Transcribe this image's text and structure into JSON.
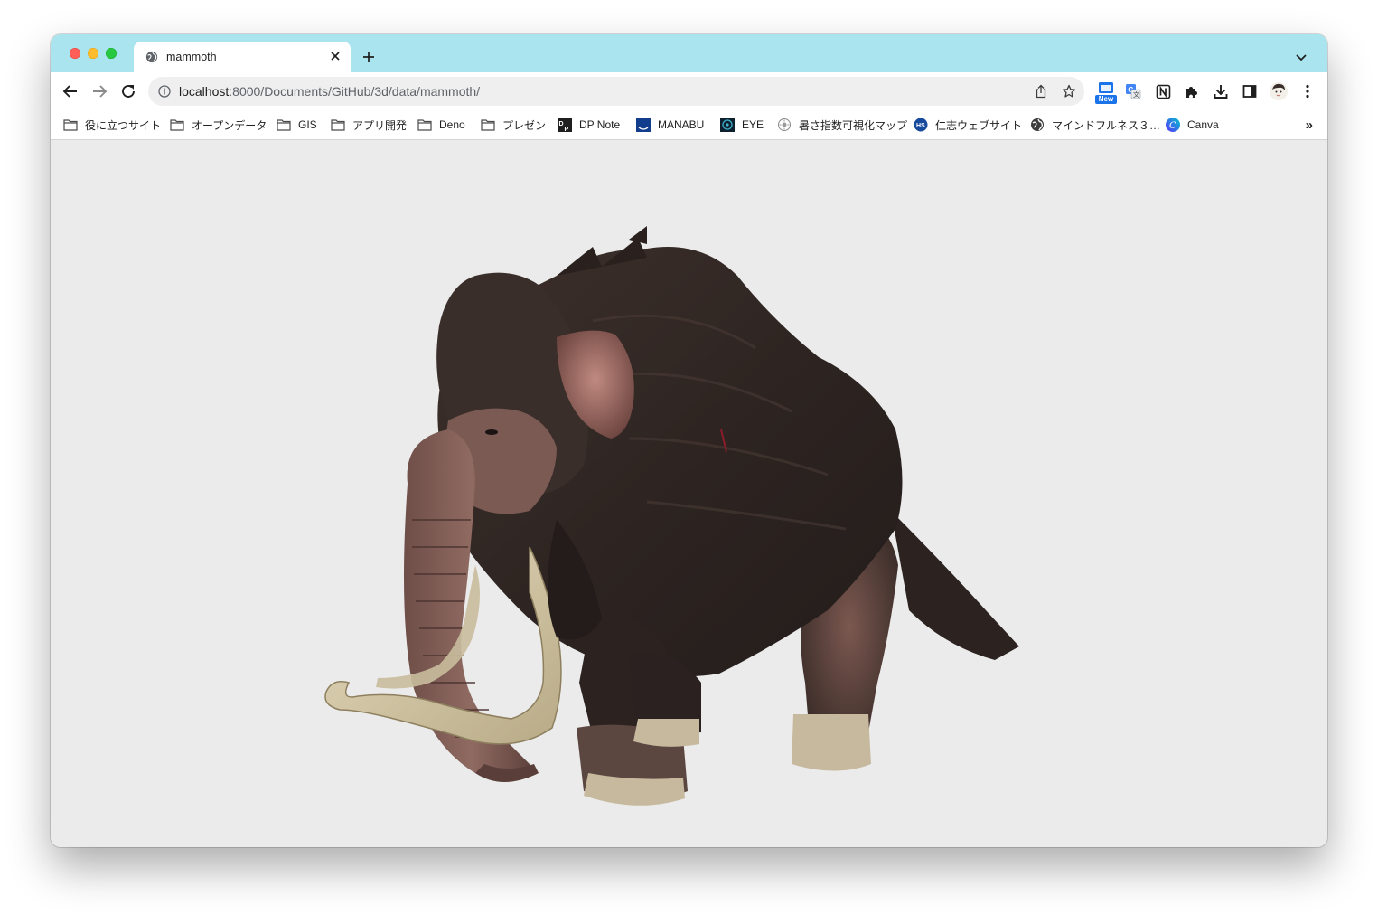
{
  "tab": {
    "title": "mammoth",
    "favicon": "globe-icon"
  },
  "toolbar": {
    "url_host": "localhost",
    "url_path": ":8000/Documents/GitHub/3d/data/mammoth/",
    "new_badge": "New"
  },
  "bookmarks": [
    {
      "label": "役に立つサイト",
      "icon": "folder-icon"
    },
    {
      "label": "オープンデータ",
      "icon": "folder-icon"
    },
    {
      "label": "GIS",
      "icon": "folder-icon"
    },
    {
      "label": "アプリ開発",
      "icon": "folder-icon"
    },
    {
      "label": "Deno",
      "icon": "folder-icon"
    },
    {
      "label": "プレゼン",
      "icon": "folder-icon"
    },
    {
      "label": "DP Note",
      "icon": "dp-logo-icon"
    },
    {
      "label": "MANABU",
      "icon": "manabu-logo-icon"
    },
    {
      "label": "EYE",
      "icon": "eye-logo-icon"
    },
    {
      "label": "暑さ指数可視化マップ",
      "icon": "sun-icon"
    },
    {
      "label": "仁志ウェブサイト",
      "icon": "site-logo-icon"
    },
    {
      "label": "マインドフルネス３…",
      "icon": "globe-icon"
    },
    {
      "label": "Canva",
      "icon": "canva-logo-icon"
    }
  ],
  "colors": {
    "tabstrip": "#a9e4ef",
    "content_background": "#ebebeb"
  },
  "content": {
    "model": "3d-mammoth-model"
  }
}
